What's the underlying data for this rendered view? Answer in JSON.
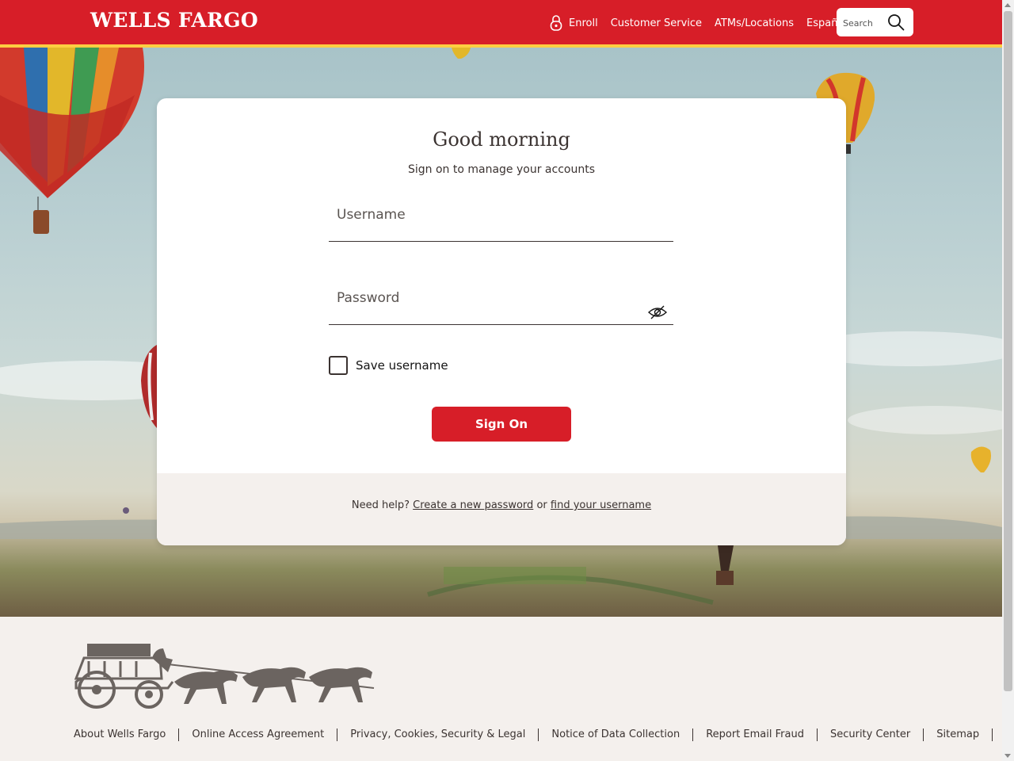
{
  "header": {
    "logo": "WELLS FARGO",
    "nav": [
      {
        "label": "Enroll",
        "icon": "lock-icon"
      },
      {
        "label": "Customer Service"
      },
      {
        "label": "ATMs/Locations"
      },
      {
        "label": "Español"
      }
    ],
    "search": {
      "placeholder": "Search",
      "icon": "search-icon"
    }
  },
  "login": {
    "greeting": "Good morning",
    "subtitle": "Sign on to manage your accounts",
    "username_placeholder": "Username",
    "password_placeholder": "Password",
    "password_toggle_icon": "eye-hidden-icon",
    "save_username_label": "Save username",
    "save_username_checked": false,
    "signon_label": "Sign On"
  },
  "help": {
    "prefix": "Need help?",
    "create_password": "Create a new password",
    "or": "or",
    "find_username": "find your username"
  },
  "footer": {
    "logo_icon": "stagecoach-icon",
    "links": [
      "About Wells Fargo",
      "Online Access Agreement",
      "Privacy, Cookies, Security & Legal",
      "Notice of Data Collection",
      "Report Email Fraud",
      "Security Center",
      "Sitemap"
    ]
  },
  "colors": {
    "brand_red": "#d71e28",
    "brand_gold": "#ffcd41",
    "footer_bg": "#f4f0ed"
  }
}
